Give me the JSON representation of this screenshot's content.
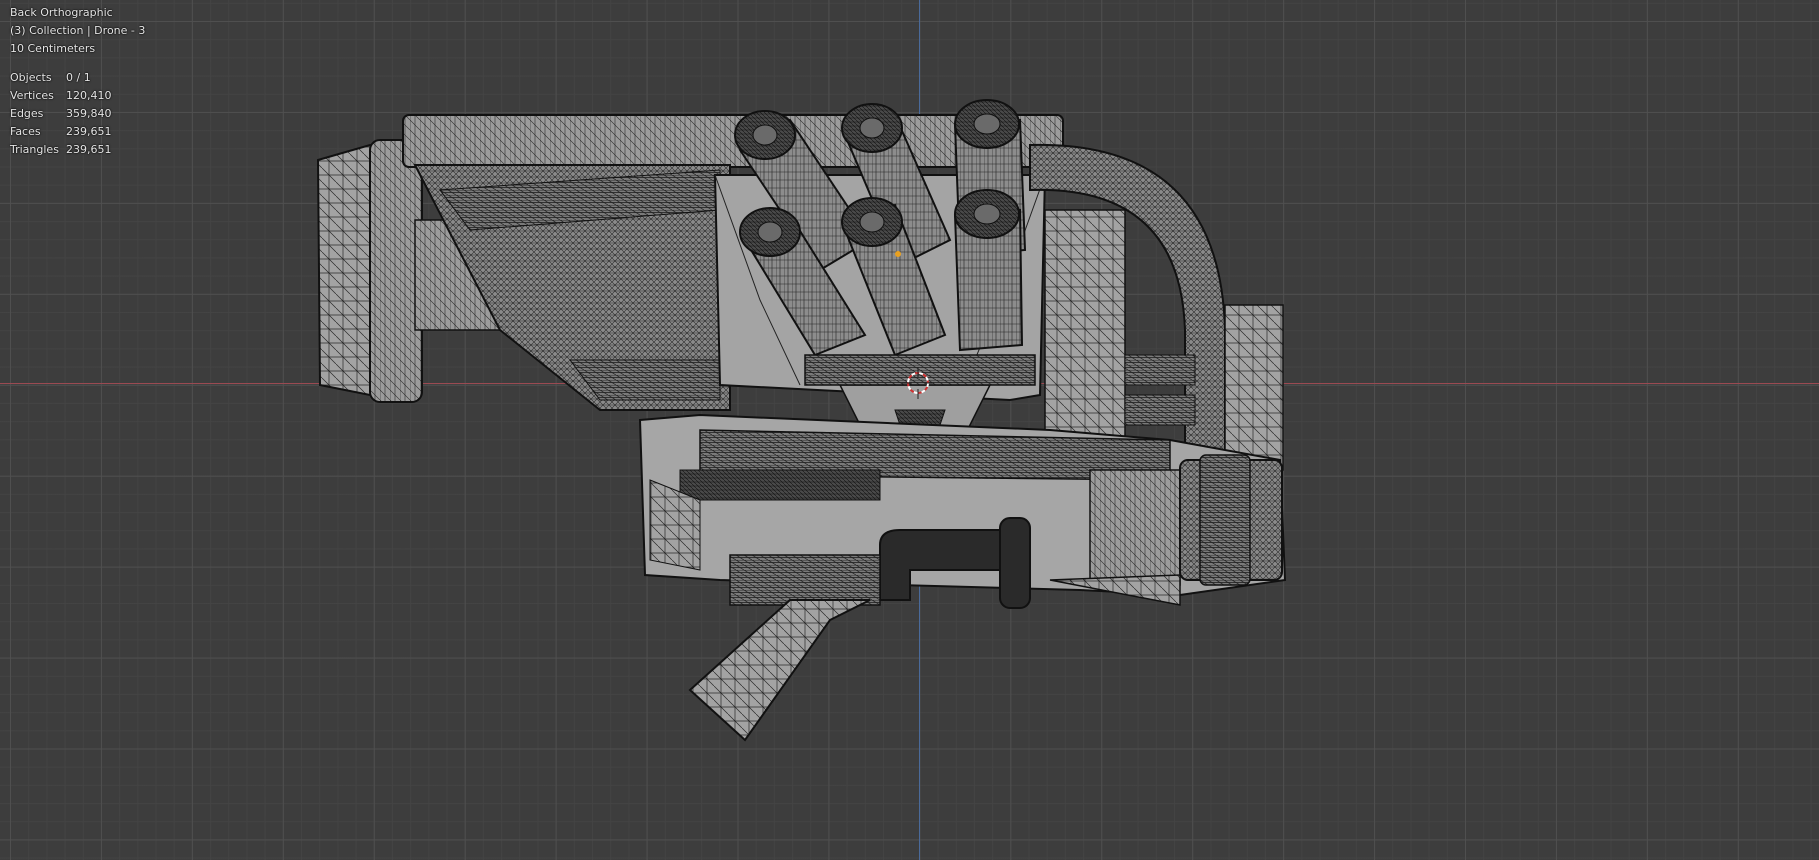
{
  "viewport": {
    "view_name": "Back Orthographic",
    "collection": "(3) Collection | Drone - 3",
    "scale": "10 Centimeters",
    "stats": [
      {
        "label": "Objects",
        "value": "0 / 1"
      },
      {
        "label": "Vertices",
        "value": "120,410"
      },
      {
        "label": "Edges",
        "value": "359,840"
      },
      {
        "label": "Faces",
        "value": "239,651"
      },
      {
        "label": "Triangles",
        "value": "239,651"
      }
    ]
  },
  "colors": {
    "background": "#3d3d3d",
    "x_axis": "#9b4a52",
    "z_axis": "#4a6a9a",
    "mesh_fill": "#9a9a9a",
    "wire": "#1a1a1a"
  },
  "object": {
    "name_icon": "drone-mesh-model",
    "cursor_icon": "3d-cursor-icon"
  }
}
